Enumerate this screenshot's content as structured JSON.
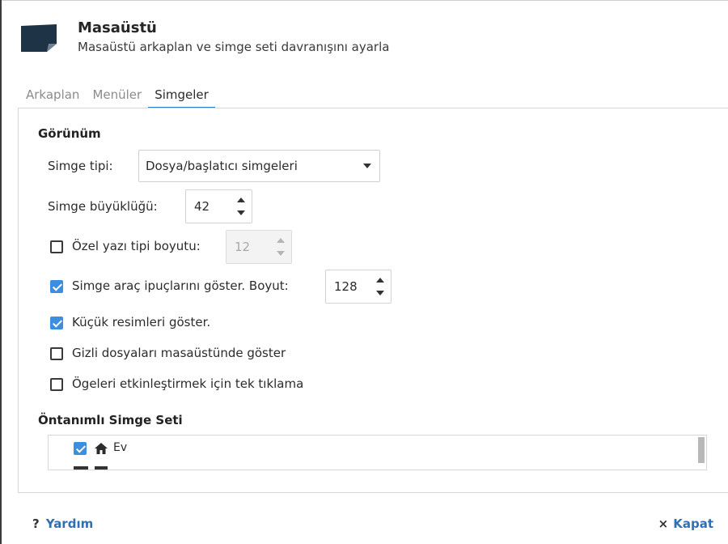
{
  "header": {
    "title": "Masaüstü",
    "subtitle": "Masaüstü arkaplan ve simge seti davranışını ayarla",
    "icon": "desktop-icon"
  },
  "tabs": [
    {
      "label": "Arkaplan",
      "active": false
    },
    {
      "label": "Menüler",
      "active": false
    },
    {
      "label": "Simgeler",
      "active": true
    }
  ],
  "appearance": {
    "section_title": "Görünüm",
    "icon_type": {
      "label": "Simge tipi:",
      "value": "Dosya/başlatıcı simgeleri"
    },
    "icon_size": {
      "label": "Simge büyüklüğü:",
      "value": "42"
    },
    "custom_font": {
      "label": "Özel yazı tipi boyutu:",
      "value": "12",
      "checked": false,
      "enabled": false
    },
    "tooltips": {
      "label": "Simge araç ipuçlarını göster. Boyut:",
      "value": "128",
      "checked": true
    },
    "thumbnails": {
      "label": "Küçük resimleri göster.",
      "checked": true
    },
    "hidden_files": {
      "label": "Gizli dosyaları masaüstünde göster",
      "checked": false
    },
    "single_click": {
      "label": "Ögeleri etkinleştirmek için tek tıklama",
      "checked": false
    }
  },
  "default_icons": {
    "section_title": "Öntanımlı Simge Seti",
    "items": [
      {
        "label": "Ev",
        "checked": true,
        "icon": "home-icon"
      }
    ]
  },
  "footer": {
    "help_label": "Yardım",
    "close_label": "Kapat"
  },
  "colors": {
    "accent": "#3b8ee0",
    "link": "#2f6fb5"
  }
}
